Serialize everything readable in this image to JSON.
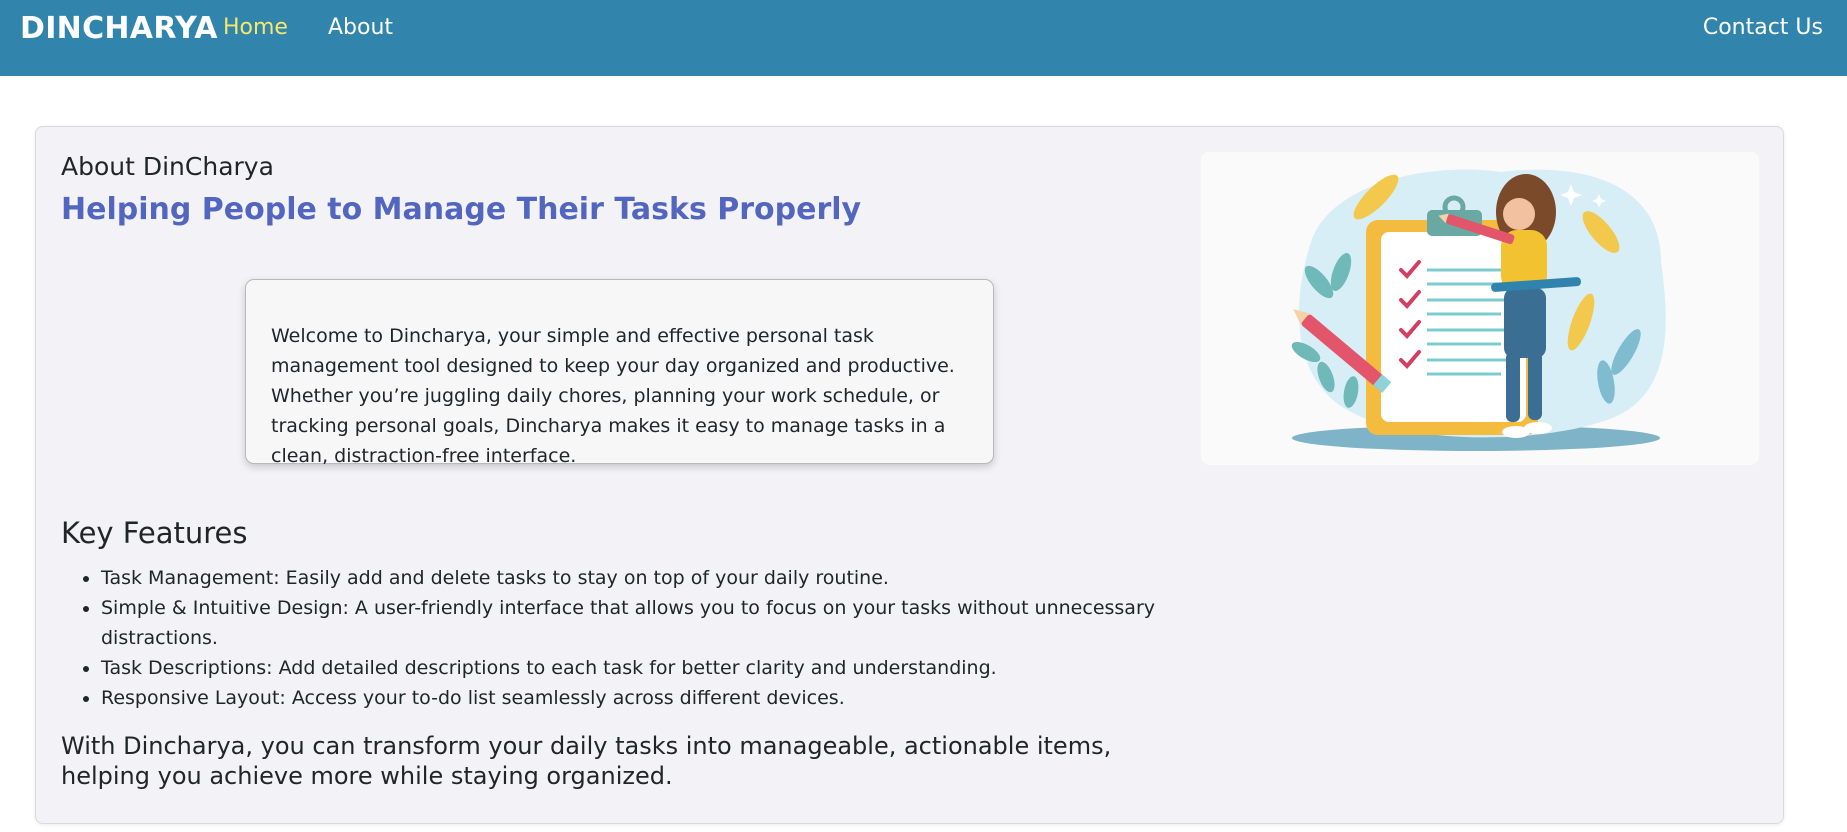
{
  "navbar": {
    "brand": "DINCHARYA",
    "links": [
      {
        "label": "Home",
        "active": true
      },
      {
        "label": "About",
        "active": false
      }
    ],
    "contact_label": "Contact Us",
    "background_color": "#3184ac",
    "active_link_color": "#f5e86b"
  },
  "about": {
    "heading": "About DinCharya",
    "tagline": "Helping People to Manage Their Tasks Properly",
    "tagline_color": "#5266c0",
    "welcome_text": "Welcome to Dincharya, your simple and effective personal task management tool designed to keep your day organized and productive. Whether you’re juggling daily chores, planning your work schedule, or tracking personal goals, Dincharya makes it easy to manage tasks in a clean, distraction-free interface.",
    "illustration_icon": "task-checklist-illustration"
  },
  "features": {
    "heading": "Key Features",
    "items": [
      "Task Management: Easily add and delete tasks to stay on top of your daily routine.",
      "Simple & Intuitive Design: A user-friendly interface that allows you to focus on your tasks without unnecessary distractions.",
      "Task Descriptions: Add detailed descriptions to each task for better clarity and understanding.",
      "Responsive Layout: Access your to-do list seamlessly across different devices."
    ]
  },
  "closing": {
    "text": "With Dincharya, you can transform your daily tasks into manageable, actionable items, helping you achieve more while staying organized."
  }
}
